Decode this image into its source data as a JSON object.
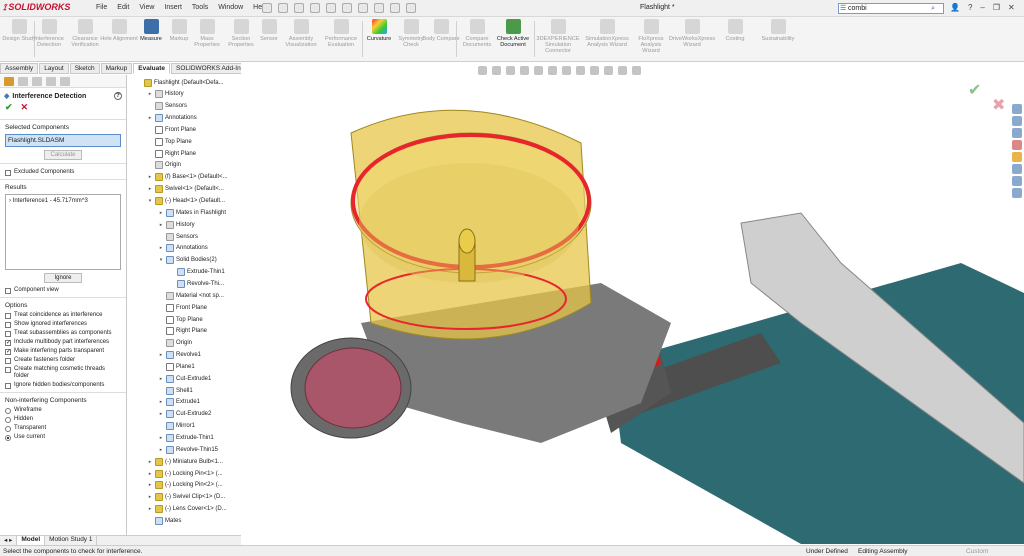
{
  "app": {
    "brand": "SOLIDWORKS",
    "menus": [
      "File",
      "Edit",
      "View",
      "Insert",
      "Tools",
      "Window",
      "Help"
    ],
    "doc_title": "Flashlight *",
    "search_value": "combi",
    "window_controls": [
      "?",
      "–",
      "❐",
      "✕"
    ]
  },
  "ribbon": {
    "buttons": [
      {
        "label": "Design Study"
      },
      {
        "label": "Interference Detection"
      },
      {
        "label": "Clearance Verification"
      },
      {
        "label": "Hole Alignment"
      },
      {
        "label": "Measure"
      },
      {
        "label": "Markup"
      },
      {
        "label": "Mass Properties"
      },
      {
        "label": "Section Properties"
      },
      {
        "label": "Sensor"
      },
      {
        "label": "Assembly Visualization"
      },
      {
        "label": "Performance Evaluation"
      },
      {
        "label": "Curvature"
      },
      {
        "label": "Symmetry Check"
      },
      {
        "label": "Body Compare"
      },
      {
        "label": "Compare Documents"
      },
      {
        "label": "Check Active Document"
      },
      {
        "label": "3DEXPERIENCE Simulation Connector"
      },
      {
        "label": "SimulationXpress Analysis Wizard"
      },
      {
        "label": "FloXpress Analysis Wizard"
      },
      {
        "label": "DriveWorksXpress Wizard"
      },
      {
        "label": "Costing"
      },
      {
        "label": "Sustainability"
      }
    ]
  },
  "cmd_tabs": [
    "Assembly",
    "Layout",
    "Sketch",
    "Markup",
    "Evaluate",
    "SOLIDWORKS Add-Ins"
  ],
  "property_manager": {
    "title": "Interference Detection",
    "selected_components_header": "Selected Components",
    "selected_item": "Flashlight.SLDASM",
    "calculate_label": "Calculate",
    "excluded_label": "Excluded Components",
    "results_header": "Results",
    "result_item": "Interference1 - 45.717mm^3",
    "ignore_label": "Ignore",
    "component_view_label": "Component view",
    "options_header": "Options",
    "options": [
      {
        "label": "Treat coincidence as interference",
        "checked": false
      },
      {
        "label": "Show ignored interferences",
        "checked": false
      },
      {
        "label": "Treat subassemblies as components",
        "checked": false
      },
      {
        "label": "Include multibody part interferences",
        "checked": true
      },
      {
        "label": "Make interfering parts transparent",
        "checked": true
      },
      {
        "label": "Create fasteners folder",
        "checked": false
      },
      {
        "label": "Create matching cosmetic threads folder",
        "checked": false
      },
      {
        "label": "Ignore hidden bodies/components",
        "checked": false
      }
    ],
    "non_interfering_header": "Non-interfering Components",
    "radio": [
      {
        "label": "Wireframe",
        "on": false
      },
      {
        "label": "Hidden",
        "on": false
      },
      {
        "label": "Transparent",
        "on": false
      },
      {
        "label": "Use current",
        "on": true
      }
    ]
  },
  "tree": [
    {
      "label": "Flashlight  (Default<Defa...",
      "icon": "y",
      "ex": "",
      "ind": 0
    },
    {
      "label": "History",
      "icon": "g",
      "ex": "▸",
      "ind": 1
    },
    {
      "label": "Sensors",
      "icon": "g",
      "ex": "",
      "ind": 1
    },
    {
      "label": "Annotations",
      "icon": "b",
      "ex": "▸",
      "ind": 1
    },
    {
      "label": "Front Plane",
      "icon": "p",
      "ex": "",
      "ind": 1
    },
    {
      "label": "Top Plane",
      "icon": "p",
      "ex": "",
      "ind": 1
    },
    {
      "label": "Right Plane",
      "icon": "p",
      "ex": "",
      "ind": 1
    },
    {
      "label": "Origin",
      "icon": "g",
      "ex": "",
      "ind": 1
    },
    {
      "label": "(f) Base<1> (Default<...",
      "icon": "y",
      "ex": "▸",
      "ind": 1
    },
    {
      "label": "Swivel<1> (Default<...",
      "icon": "y",
      "ex": "▸",
      "ind": 1
    },
    {
      "label": "(-) Head<1> (Default...",
      "icon": "y",
      "ex": "▾",
      "ind": 1
    },
    {
      "label": "Mates in Flashlight",
      "icon": "b",
      "ex": "▸",
      "ind": 2
    },
    {
      "label": "History",
      "icon": "g",
      "ex": "▸",
      "ind": 2
    },
    {
      "label": "Sensors",
      "icon": "g",
      "ex": "",
      "ind": 2
    },
    {
      "label": "Annotations",
      "icon": "b",
      "ex": "▸",
      "ind": 2
    },
    {
      "label": "Solid Bodies(2)",
      "icon": "b",
      "ex": "▾",
      "ind": 2
    },
    {
      "label": "Extrude-Thin1",
      "icon": "b",
      "ex": "",
      "ind": 3
    },
    {
      "label": "Revolve-Thi...",
      "icon": "b",
      "ex": "",
      "ind": 3
    },
    {
      "label": "Material <not sp...",
      "icon": "g",
      "ex": "",
      "ind": 2
    },
    {
      "label": "Front Plane",
      "icon": "p",
      "ex": "",
      "ind": 2
    },
    {
      "label": "Top Plane",
      "icon": "p",
      "ex": "",
      "ind": 2
    },
    {
      "label": "Right Plane",
      "icon": "p",
      "ex": "",
      "ind": 2
    },
    {
      "label": "Origin",
      "icon": "g",
      "ex": "",
      "ind": 2
    },
    {
      "label": "Revolve1",
      "icon": "b",
      "ex": "▸",
      "ind": 2
    },
    {
      "label": "Plane1",
      "icon": "p",
      "ex": "",
      "ind": 2
    },
    {
      "label": "Cut-Extrude1",
      "icon": "b",
      "ex": "▸",
      "ind": 2
    },
    {
      "label": "Shell1",
      "icon": "b",
      "ex": "",
      "ind": 2
    },
    {
      "label": "Extrude1",
      "icon": "b",
      "ex": "▸",
      "ind": 2
    },
    {
      "label": "Cut-Extrude2",
      "icon": "b",
      "ex": "▸",
      "ind": 2
    },
    {
      "label": "Mirror1",
      "icon": "b",
      "ex": "",
      "ind": 2
    },
    {
      "label": "Extrude-Thin1",
      "icon": "b",
      "ex": "▸",
      "ind": 2
    },
    {
      "label": "Revolve-Thin15",
      "icon": "b",
      "ex": "▸",
      "ind": 2
    },
    {
      "label": "(-) Miniature Bulb<1...",
      "icon": "y",
      "ex": "▸",
      "ind": 1
    },
    {
      "label": "(-) Locking Pin<1> (...",
      "icon": "y",
      "ex": "▸",
      "ind": 1
    },
    {
      "label": "(-) Locking Pin<2> (...",
      "icon": "y",
      "ex": "▸",
      "ind": 1
    },
    {
      "label": "(-) Swivel Clip<1> (D...",
      "icon": "y",
      "ex": "▸",
      "ind": 1
    },
    {
      "label": "(-) Lens Cover<1> (D...",
      "icon": "y",
      "ex": "▸",
      "ind": 1
    },
    {
      "label": "Mates",
      "icon": "b",
      "ex": "",
      "ind": 1
    }
  ],
  "bottom_tabs": [
    "Model",
    "Motion Study 1"
  ],
  "status": {
    "message": "Select the components to check for interference.",
    "s1": "Under Defined",
    "s2": "Editing Assembly",
    "s3": "Custom"
  },
  "colors": {
    "brand_red": "#c8102e",
    "housing_yellow": "#e6c54a",
    "interference_red": "#e8252d",
    "barrel_teal": "#2e6a72",
    "lens_mauve": "#a9566a"
  }
}
